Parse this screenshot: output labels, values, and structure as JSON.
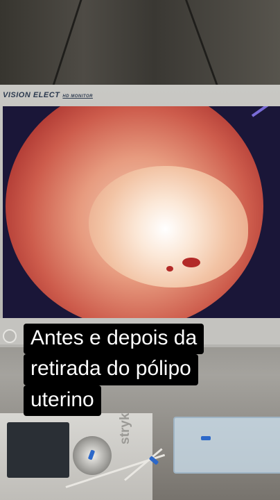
{
  "monitor": {
    "brand": "VISION ELECT",
    "brand_sub": "HD MONITOR"
  },
  "device": {
    "brand": "stryk"
  },
  "caption": {
    "lines": [
      "Antes e depois da",
      "retirada do pólipo",
      "uterino"
    ]
  },
  "colors": {
    "caption_background": "#000000",
    "caption_text": "#ffffff",
    "tissue": "#cd5c4c",
    "polyp": "#fbe7d6"
  }
}
